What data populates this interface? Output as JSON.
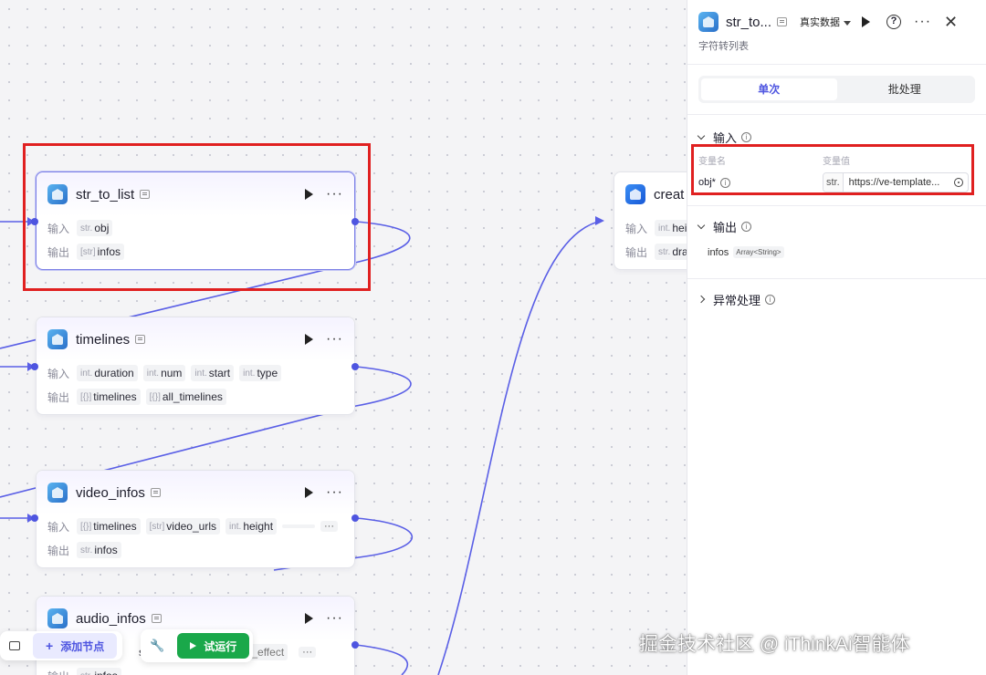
{
  "colors": {
    "accent": "#4e55e0",
    "run": "#1aa84a",
    "highlight": "#e02020"
  },
  "nodes": {
    "str_to_list": {
      "title": "str_to_list",
      "input_label": "输入",
      "output_label": "输出",
      "inputs": [
        {
          "type": "str.",
          "name": "obj"
        }
      ],
      "outputs": [
        {
          "type": "[str]",
          "name": "infos"
        }
      ]
    },
    "timelines": {
      "title": "timelines",
      "input_label": "输入",
      "output_label": "输出",
      "inputs": [
        {
          "type": "int.",
          "name": "duration"
        },
        {
          "type": "int.",
          "name": "num"
        },
        {
          "type": "int.",
          "name": "start"
        },
        {
          "type": "int.",
          "name": "type"
        }
      ],
      "outputs": [
        {
          "type": "[{}]",
          "name": "timelines"
        },
        {
          "type": "[{}]",
          "name": "all_timelines"
        }
      ]
    },
    "video_infos": {
      "title": "video_infos",
      "input_label": "输入",
      "output_label": "输出",
      "inputs": [
        {
          "type": "[{}]",
          "name": "timelines"
        },
        {
          "type": "[str]",
          "name": "video_urls"
        },
        {
          "type": "int.",
          "name": "height"
        }
      ],
      "outputs": [
        {
          "type": "str.",
          "name": "infos"
        }
      ]
    },
    "audio_infos": {
      "title": "audio_infos",
      "output_label": "输出",
      "inputs_partial": [
        "s",
        "io_effect"
      ],
      "outputs": [
        {
          "type": "str.",
          "name": "infos"
        }
      ]
    },
    "create": {
      "title": "creat",
      "input_label": "输入",
      "output_label": "输出",
      "inputs": [
        {
          "type": "int.",
          "name": "hei"
        }
      ],
      "outputs": [
        {
          "type": "str.",
          "name": "dra"
        }
      ]
    }
  },
  "panel": {
    "title": "str_to...",
    "data_mode": "真实数据",
    "subtitle": "字符转列表",
    "tabs": [
      "单次",
      "批处理"
    ],
    "input_section": "输入",
    "col_name": "变量名",
    "col_value": "变量值",
    "var_name": "obj*",
    "var_type": "str.",
    "var_value": "https://ve-template...",
    "output_section": "输出",
    "output_name": "infos",
    "output_type": "Array<String>",
    "error_section": "异常处理"
  },
  "toolbar": {
    "add_node": "添加节点",
    "test_run": "试运行"
  },
  "watermark": "掘金技术社区 @ iThinkAi智能体"
}
